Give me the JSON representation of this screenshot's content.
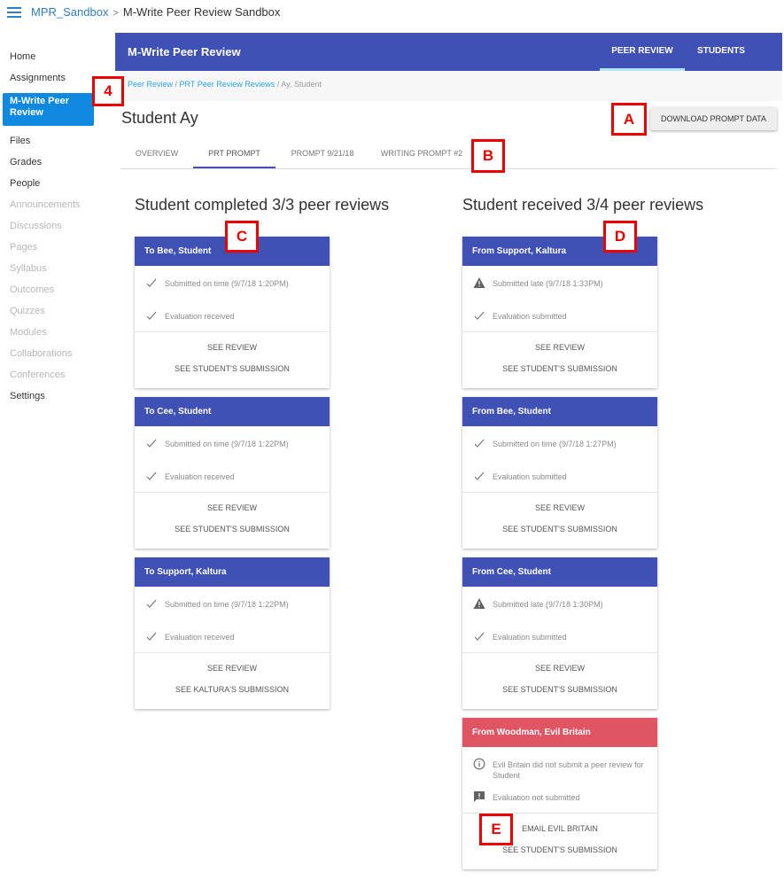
{
  "topbar": {
    "course": "MPR_Sandbox",
    "separator": ">",
    "page": "M-Write Peer Review Sandbox"
  },
  "sidebar": {
    "items": [
      {
        "label": "Home",
        "state": "normal"
      },
      {
        "label": "Assignments",
        "state": "normal"
      },
      {
        "label": "M-Write Peer Review",
        "state": "active"
      },
      {
        "label": "Files",
        "state": "normal"
      },
      {
        "label": "Grades",
        "state": "normal"
      },
      {
        "label": "People",
        "state": "normal"
      },
      {
        "label": "Announcements",
        "state": "disabled"
      },
      {
        "label": "Discussions",
        "state": "disabled"
      },
      {
        "label": "Pages",
        "state": "disabled"
      },
      {
        "label": "Syllabus",
        "state": "disabled"
      },
      {
        "label": "Outcomes",
        "state": "disabled"
      },
      {
        "label": "Quizzes",
        "state": "disabled"
      },
      {
        "label": "Modules",
        "state": "disabled"
      },
      {
        "label": "Collaborations",
        "state": "disabled"
      },
      {
        "label": "Conferences",
        "state": "disabled"
      },
      {
        "label": "Settings",
        "state": "normal"
      }
    ]
  },
  "appbar": {
    "title": "M-Write Peer Review",
    "tabs": [
      {
        "label": "PEER REVIEW",
        "active": true
      },
      {
        "label": "STUDENTS",
        "active": false
      }
    ]
  },
  "breadcrumb": {
    "link1": "Peer Review",
    "link2": "PRT Peer Review Reviews",
    "current": "Ay, Student",
    "sep": " / "
  },
  "student": {
    "name": "Student Ay"
  },
  "download_button": "DOWNLOAD PROMPT DATA",
  "tabs": [
    {
      "label": "OVERVIEW"
    },
    {
      "label": "PRT PROMPT",
      "active": true
    },
    {
      "label": "PROMPT 9/21/18"
    },
    {
      "label": "WRITING PROMPT #2"
    }
  ],
  "completed": {
    "heading": "Student completed 3/3 peer reviews",
    "cards": [
      {
        "title": "To Bee, Student",
        "rows": [
          {
            "icon": "check",
            "text": "Submitted on time (9/7/18 1:20PM)"
          },
          {
            "icon": "check",
            "text": "Evaluation received"
          }
        ],
        "actions": [
          "SEE REVIEW",
          "SEE STUDENT'S SUBMISSION"
        ]
      },
      {
        "title": "To Cee, Student",
        "rows": [
          {
            "icon": "check",
            "text": "Submitted on time (9/7/18 1:22PM)"
          },
          {
            "icon": "check",
            "text": "Evaluation received"
          }
        ],
        "actions": [
          "SEE REVIEW",
          "SEE STUDENT'S SUBMISSION"
        ]
      },
      {
        "title": "To Support, Kaltura",
        "rows": [
          {
            "icon": "check",
            "text": "Submitted on time (9/7/18 1:22PM)"
          },
          {
            "icon": "check",
            "text": "Evaluation received"
          }
        ],
        "actions": [
          "SEE REVIEW",
          "SEE KALTURA'S SUBMISSION"
        ]
      }
    ]
  },
  "received": {
    "heading": "Student received 3/4 peer reviews",
    "cards": [
      {
        "title": "From Support, Kaltura",
        "rows": [
          {
            "icon": "warning",
            "text": "Submitted late (9/7/18 1:33PM)"
          },
          {
            "icon": "check",
            "text": "Evaluation submitted"
          }
        ],
        "actions": [
          "SEE REVIEW",
          "SEE STUDENT'S SUBMISSION"
        ]
      },
      {
        "title": "From Bee, Student",
        "rows": [
          {
            "icon": "check",
            "text": "Submitted on time (9/7/18 1:27PM)"
          },
          {
            "icon": "check",
            "text": "Evaluation submitted"
          }
        ],
        "actions": [
          "SEE REVIEW",
          "SEE STUDENT'S SUBMISSION"
        ]
      },
      {
        "title": "From Cee, Student",
        "rows": [
          {
            "icon": "warning",
            "text": "Submitted late (9/7/18 1:30PM)"
          },
          {
            "icon": "check",
            "text": "Evaluation submitted"
          }
        ],
        "actions": [
          "SEE REVIEW",
          "SEE STUDENT'S SUBMISSION"
        ]
      },
      {
        "title": "From Woodman, Evil Britain",
        "alert": true,
        "rows": [
          {
            "icon": "info",
            "text": "Evil Britain did not submit a peer review for Student"
          },
          {
            "icon": "feedback",
            "text": "Evaluation not submitted"
          }
        ],
        "actions": [
          "EMAIL EVIL BRITAIN",
          "SEE STUDENT'S SUBMISSION"
        ]
      }
    ]
  },
  "markers": [
    "4",
    "A",
    "B",
    "C",
    "D",
    "E"
  ],
  "colors": {
    "primary": "#3f51b5",
    "alert": "#e05563",
    "sidebar_active": "#0f89e0",
    "marker": "#ee0000"
  }
}
